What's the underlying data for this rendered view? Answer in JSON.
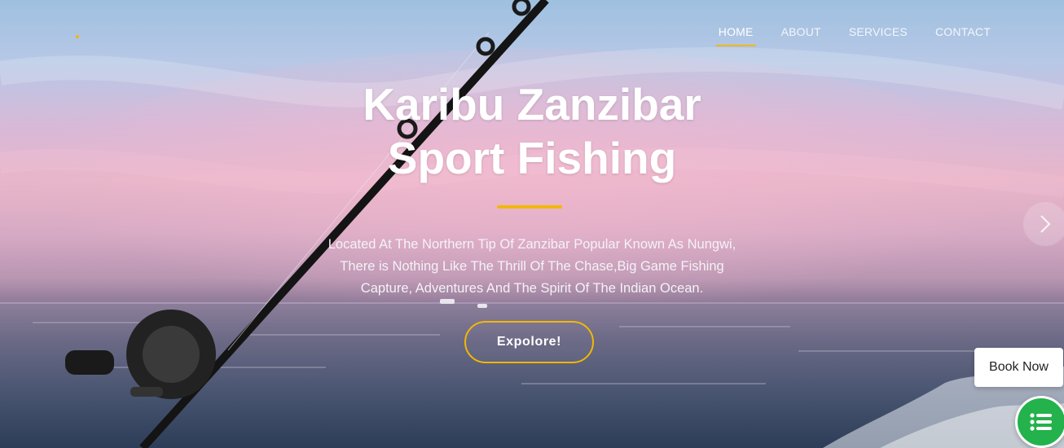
{
  "brand": {
    "accent": "#f2b705",
    "fab_color": "#23b24b"
  },
  "nav": {
    "items": [
      {
        "label": "HOME",
        "active": true
      },
      {
        "label": "ABOUT",
        "active": false
      },
      {
        "label": "SERVICES",
        "active": false
      },
      {
        "label": "CONTACT",
        "active": false
      }
    ]
  },
  "hero": {
    "title_line1": "Karibu Zanzibar",
    "title_line2": "Sport Fishing",
    "description_lines": [
      "Located At The Northern Tip Of Zanzibar Popular Known As Nungwi,",
      "There is Nothing Like The Thrill Of The Chase,Big Game Fishing",
      "Capture, Adventures And The Spirit Of The Indian Ocean."
    ],
    "cta_label": "Expolore!",
    "next_icon": "chevron-right-icon"
  },
  "floating": {
    "book_now_label": "Book Now",
    "chat_icon": "list-icon"
  }
}
